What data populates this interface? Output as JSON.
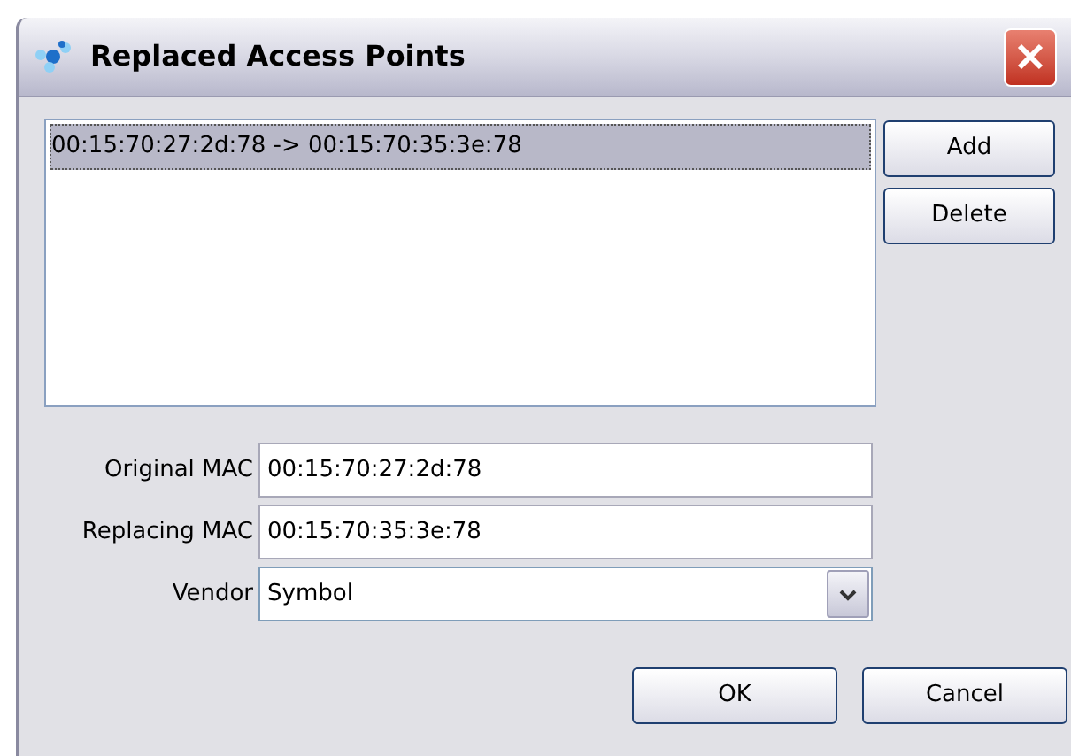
{
  "window": {
    "title": "Replaced Access Points"
  },
  "list": {
    "items": [
      {
        "label": "00:15:70:27:2d:78 -> 00:15:70:35:3e:78",
        "selected": true
      }
    ]
  },
  "side_buttons": [
    "Add",
    "Delete"
  ],
  "fields": [
    {
      "label": "Original MAC",
      "value": "00:15:70:27:2d:78",
      "kind": "text"
    },
    {
      "label": "Replacing MAC",
      "value": "00:15:70:35:3e:78",
      "kind": "text"
    },
    {
      "label": "Vendor",
      "value": "Symbol",
      "kind": "dropdown"
    }
  ],
  "buttons": [
    "OK",
    "Cancel"
  ]
}
